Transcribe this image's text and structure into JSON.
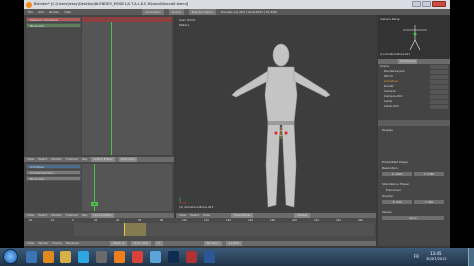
{
  "window": {
    "title": "Blender* [C:\\Users\\Jessy\\Desktop\\BLENDER_MODEL\\S.T.A.L.K.E.R\\bandit\\bandit.blend]"
  },
  "info_header": {
    "menus": [
      "File",
      "Add",
      "Render",
      "Help"
    ],
    "screen": "Animation",
    "scene": "Scene",
    "engine": "Blender Game",
    "version_stats": "blender.org 263 | Ve:5/4561 | Fa:3/86"
  },
  "dopesheet": {
    "channels": [
      "Skeleton Armature",
      "Bone.011"
    ]
  },
  "viewport": {
    "label_view": "User Ortho",
    "label_ctx": "Meters",
    "selected": "(1) Armature.Bone.011",
    "mode": "Pose Mode",
    "pivot": "Global",
    "menus": [
      "View",
      "Select",
      "Pose"
    ]
  },
  "action_editor": {
    "menus": [
      "View",
      "Select",
      "Marker",
      "Channel",
      "Key"
    ],
    "mode": "Action Editor",
    "summary": "Summary",
    "channels": [
      "Armature",
      "ArmatureAction",
      "Bone.011"
    ],
    "current_frame": "0"
  },
  "outliner": {
    "header": "All Scenes",
    "items": [
      "Scene",
      "RenderLayers",
      "World",
      "Armature",
      "bandit",
      "Camera",
      "Camera.001",
      "Lamp",
      "Lamp.001"
    ]
  },
  "mini_view": {
    "label": "Camera Persp",
    "sub": "(1) Armature.Bone.011"
  },
  "properties": {
    "section_display": "Display",
    "section_embedded": "Embedded Player",
    "resolution": "Resolution:",
    "res_x": "X: 1920",
    "res_y": "Y: 1080",
    "section_standalone": "Standalone Player",
    "fullscreen": "Fullscreen",
    "quality": "Quality:",
    "res_x2": "X: 640",
    "res_y2": "Y: 480",
    "stereo": "Stereo",
    "none_label": "None"
  },
  "timeline": {
    "menus": [
      "View",
      "Marker",
      "Frame",
      "Playback"
    ],
    "start": "Start: 1",
    "end": "End: 250",
    "current": "0",
    "sync": "No Sync",
    "keying": "LocRot",
    "ticks": [
      "-40",
      "-20",
      "0",
      "20",
      "40",
      "60",
      "80",
      "100",
      "120",
      "140",
      "160",
      "180",
      "200",
      "220",
      "240",
      "260"
    ]
  },
  "graph_header": {
    "menus": [
      "View",
      "Select",
      "Marker",
      "Channel",
      "Key"
    ],
    "mode": "Curve Editor"
  },
  "taskbar": {
    "lang": "FR",
    "time": "13:45",
    "date": "30/07/2012"
  },
  "colors": {
    "taskbar": "#2a425c",
    "viewport_bg": "#3d3d3d",
    "selection": "#e6a33a",
    "green_marker": "#4cc24c"
  }
}
